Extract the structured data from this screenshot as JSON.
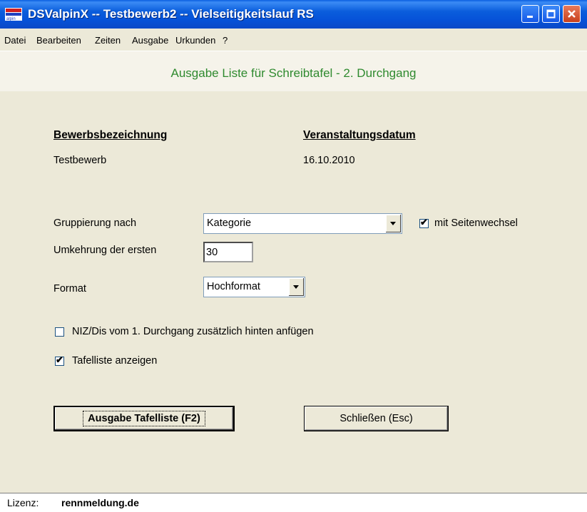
{
  "window": {
    "title": "DSValpinX -- Testbewerb2 -- Vielseitigkeitslauf RS",
    "app_icon_text": "alpin"
  },
  "menu": {
    "items": [
      "Datei",
      "Bearbeiten",
      "Zeiten",
      "Ausgabe",
      "Urkunden",
      "?"
    ]
  },
  "heading": "Ausgabe Liste für Schreibtafel - 2. Durchgang",
  "header_info": {
    "bewerb_label": "Bewerbsbezeichnung",
    "bewerb_value": "Testbewerb",
    "datum_label": "Veranstaltungsdatum",
    "datum_value": "16.10.2010"
  },
  "form": {
    "gruppierung_label": "Gruppierung nach",
    "gruppierung_value": "Kategorie",
    "seitenwechsel_label": "mit Seitenwechsel",
    "seitenwechsel_checked": true,
    "umkehrung_label": "Umkehrung der ersten",
    "umkehrung_value": "30",
    "format_label": "Format",
    "format_value": "Hochformat",
    "niz_label": "NIZ/Dis vom 1. Durchgang zusätzlich hinten anfügen",
    "niz_checked": false,
    "tafelliste_label": "Tafelliste anzeigen",
    "tafelliste_checked": true
  },
  "buttons": {
    "ausgabe": "Ausgabe Tafelliste (F2)",
    "schliessen": "Schließen (Esc)"
  },
  "status": {
    "lizenz_label": "Lizenz:",
    "lizenz_value": "rennmeldung.de"
  },
  "colors": {
    "heading": "#2f8a2f",
    "titlebar": "#0a5ddc",
    "background": "#ece9d8"
  }
}
